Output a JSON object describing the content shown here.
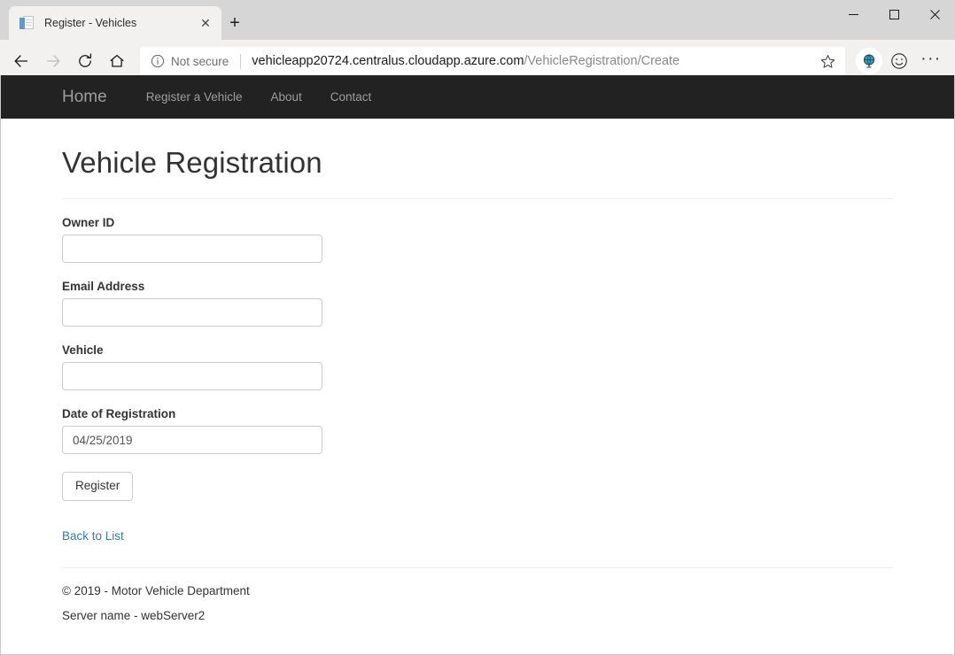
{
  "browser": {
    "tab": {
      "title": "Register - Vehicles",
      "favicon": "page-document-icon",
      "close_label": "✕"
    },
    "new_tab_label": "+",
    "window_controls": {
      "minimize": "minimize-icon",
      "maximize": "maximize-icon",
      "close": "close-icon"
    },
    "nav": {
      "back": "back-arrow-icon",
      "forward": "forward-arrow-icon",
      "refresh": "refresh-icon",
      "home": "home-icon"
    },
    "omnibox": {
      "security_icon": "info-circle-icon",
      "security_label": "Not secure",
      "url_host": "vehicleapp20724.centralus.cloudapp.azure.com",
      "url_path": "/VehicleRegistration/Create",
      "star_icon": "star-icon"
    },
    "toolbar_icons": {
      "extension": "globe-extension-icon",
      "feedback": "smiley-face-icon",
      "settings": "···"
    }
  },
  "site": {
    "brand": "Home",
    "nav_links": [
      {
        "label": "Register a Vehicle"
      },
      {
        "label": "About"
      },
      {
        "label": "Contact"
      }
    ]
  },
  "page": {
    "title": "Vehicle Registration",
    "fields": [
      {
        "label": "Owner ID",
        "value": "",
        "placeholder": ""
      },
      {
        "label": "Email Address",
        "value": "",
        "placeholder": ""
      },
      {
        "label": "Vehicle",
        "value": "",
        "placeholder": ""
      },
      {
        "label": "Date of Registration",
        "value": "04/25/2019",
        "placeholder": ""
      }
    ],
    "submit_label": "Register",
    "back_link_label": "Back to List"
  },
  "footer": {
    "copyright": "© 2019 - Motor Vehicle Department",
    "server": "Server name - webServer2"
  },
  "colors": {
    "navbar_bg": "#222222",
    "navbar_text": "#9d9d9d",
    "link": "#337ab7",
    "chrome_bg": "#f2f1f0",
    "title_bar": "#d6d6d6"
  }
}
